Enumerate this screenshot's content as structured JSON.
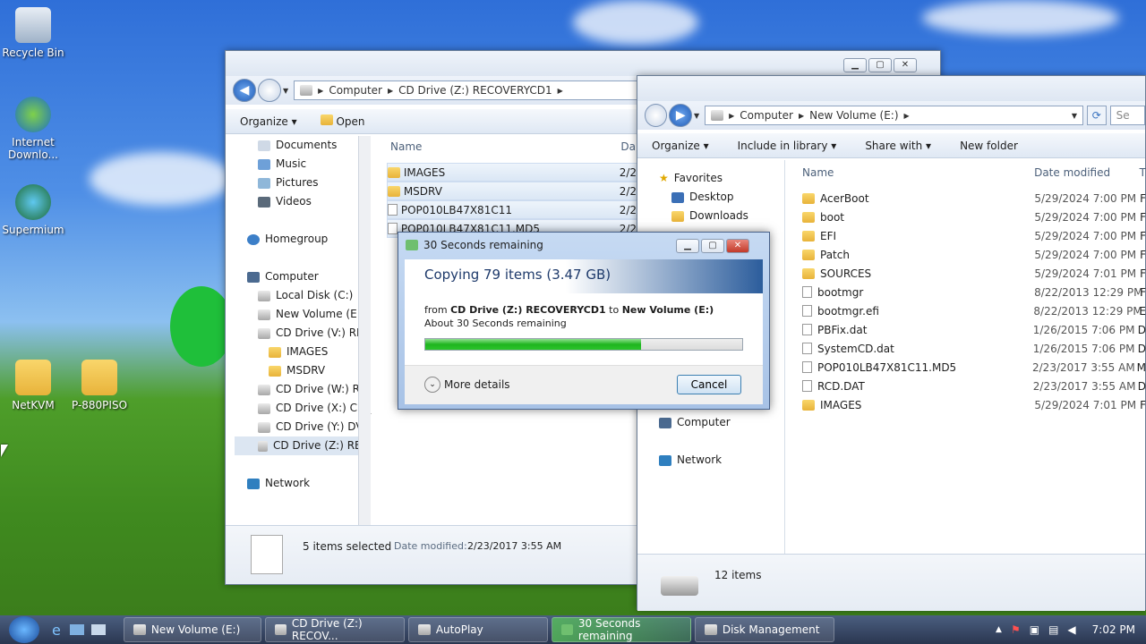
{
  "desktop": {
    "icons": [
      {
        "label": "Recycle Bin"
      },
      {
        "label": "Internet Downlo..."
      },
      {
        "label": "Supermium"
      },
      {
        "label": "NetKVM"
      },
      {
        "label": "P-880PISO"
      }
    ]
  },
  "left_window": {
    "breadcrumb": [
      "Computer",
      "CD Drive (Z:) RECOVERYCD1"
    ],
    "toolbar": {
      "organize": "Organize",
      "open": "Open"
    },
    "nav": [
      "Documents",
      "Music",
      "Pictures",
      "Videos",
      "Homegroup",
      "Computer",
      "Local Disk (C:)",
      "New Volume (E:)",
      "CD Drive (V:) REC",
      "IMAGES",
      "MSDRV",
      "CD Drive (W:) RE",
      "CD Drive (X:) CD_",
      "CD Drive (Y:) DVD",
      "CD Drive (Z:) REC",
      "Network"
    ],
    "columns": {
      "name": "Name",
      "date": "Da"
    },
    "files": [
      {
        "name": "IMAGES",
        "date": "2/2"
      },
      {
        "name": "MSDRV",
        "date": "2/2"
      },
      {
        "name": "POP010LB47X81C11",
        "date": "2/2"
      },
      {
        "name": "POP010LB47X81C11.MD5",
        "date": "2/2"
      }
    ],
    "status": {
      "selected": "5 items selected",
      "date_label": "Date modified:",
      "date_value": "2/23/2017 3:55 AM"
    }
  },
  "right_window": {
    "breadcrumb": [
      "Computer",
      "New Volume (E:)"
    ],
    "search_placeholder": "Se",
    "toolbar": {
      "organize": "Organize",
      "include": "Include in library",
      "share": "Share with",
      "new_folder": "New folder"
    },
    "nav": [
      "Favorites",
      "Desktop",
      "Downloads",
      "Computer",
      "Network"
    ],
    "columns": {
      "name": "Name",
      "date": "Date modified",
      "type": "T"
    },
    "files": [
      {
        "name": "AcerBoot",
        "date": "5/29/2024 7:00 PM",
        "t": "F",
        "folder": true
      },
      {
        "name": "boot",
        "date": "5/29/2024 7:00 PM",
        "t": "F",
        "folder": true
      },
      {
        "name": "EFI",
        "date": "5/29/2024 7:00 PM",
        "t": "F",
        "folder": true
      },
      {
        "name": "Patch",
        "date": "5/29/2024 7:00 PM",
        "t": "F",
        "folder": true
      },
      {
        "name": "SOURCES",
        "date": "5/29/2024 7:01 PM",
        "t": "F",
        "folder": true
      },
      {
        "name": "bootmgr",
        "date": "8/22/2013 12:29 PM",
        "t": "F",
        "folder": false
      },
      {
        "name": "bootmgr.efi",
        "date": "8/22/2013 12:29 PM",
        "t": "E",
        "folder": false
      },
      {
        "name": "PBFix.dat",
        "date": "1/26/2015 7:06 PM",
        "t": "D",
        "folder": false
      },
      {
        "name": "SystemCD.dat",
        "date": "1/26/2015 7:06 PM",
        "t": "D",
        "folder": false
      },
      {
        "name": "POP010LB47X81C11.MD5",
        "date": "2/23/2017 3:55 AM",
        "t": "M",
        "folder": false
      },
      {
        "name": "RCD.DAT",
        "date": "2/23/2017 3:55 AM",
        "t": "D",
        "folder": false
      },
      {
        "name": "IMAGES",
        "date": "5/29/2024 7:01 PM",
        "t": "F",
        "folder": true
      }
    ],
    "status": "12 items"
  },
  "copy_dialog": {
    "title": "30 Seconds remaining",
    "heading": "Copying 79 items (3.47 GB)",
    "from_label": "from",
    "source": "CD Drive (Z:) RECOVERYCD1",
    "to_label": "to",
    "dest": "New Volume (E:)",
    "remaining": "About 30 Seconds remaining",
    "progress": 0.68,
    "more_details": "More details",
    "cancel": "Cancel"
  },
  "taskbar": {
    "items": [
      "New Volume (E:)",
      "CD Drive (Z:) RECOV...",
      "AutoPlay",
      "30 Seconds remaining",
      "Disk Management"
    ],
    "clock": "7:02 PM"
  }
}
